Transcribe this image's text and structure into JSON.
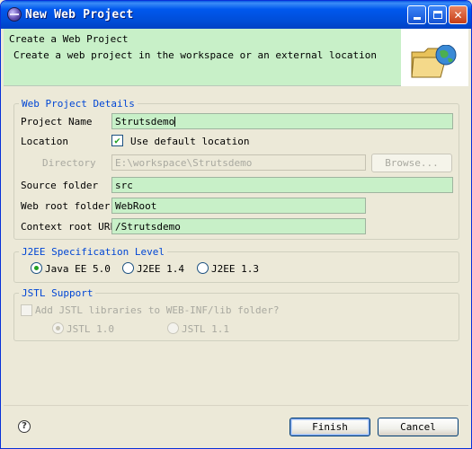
{
  "window": {
    "title": "New Web Project",
    "controls": {
      "minimize": "minimize",
      "maximize": "maximize",
      "close": "close"
    }
  },
  "banner": {
    "title": "Create a Web Project",
    "description": "Create a web project in the workspace or an external location",
    "icon": "folder-globe-icon"
  },
  "details": {
    "legend": "Web Project Details",
    "project_name_label": "Project Name",
    "project_name_value": "Strutsdemo",
    "location_label": "Location",
    "use_default_label": "Use default location",
    "use_default_checked": true,
    "directory_label": "Directory",
    "directory_value": "E:\\workspace\\Strutsdemo",
    "browse_label": "Browse...",
    "source_folder_label": "Source folder",
    "source_folder_value": "src",
    "web_root_label": "Web root folder",
    "web_root_value": "WebRoot",
    "context_root_label": "Context root URL",
    "context_root_value": "/Strutsdemo"
  },
  "j2ee": {
    "legend": "J2EE Specification Level",
    "options": [
      "Java EE 5.0",
      "J2EE 1.4",
      "J2EE 1.3"
    ],
    "selected": "Java EE 5.0"
  },
  "jstl": {
    "legend": "JSTL Support",
    "add_label": "Add JSTL libraries to WEB-INF/lib folder?",
    "add_checked": false,
    "options": [
      "JSTL 1.0",
      "JSTL 1.1"
    ],
    "selected": "JSTL 1.0"
  },
  "footer": {
    "help_icon": "help-icon",
    "finish_label": "Finish",
    "cancel_label": "Cancel"
  },
  "colors": {
    "title_bar": "#0058ee",
    "field_bg": "#c8f0c8",
    "legend_text": "#0046d5"
  }
}
